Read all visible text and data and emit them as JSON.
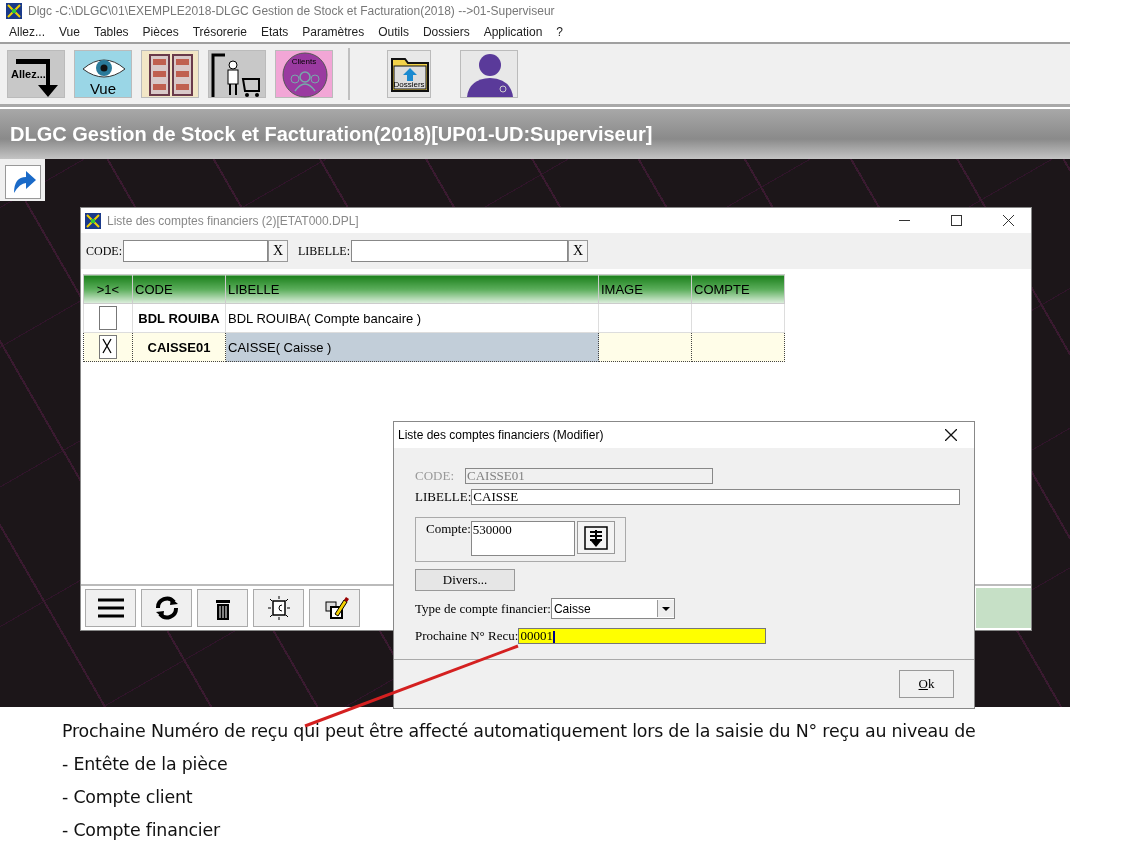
{
  "window": {
    "title": "Dlgc -C:\\DLGC\\01\\EXEMPLE2018-DLGC Gestion de Stock et Facturation(2018) -->01-Superviseur"
  },
  "menu": [
    "Allez...",
    "Vue",
    "Tables",
    "Pièces",
    "Trésorerie",
    "Etats",
    "Paramètres",
    "Outils",
    "Dossiers",
    "Application",
    "?"
  ],
  "toolbar": [
    {
      "kind": "allez",
      "label": "Allez..."
    },
    {
      "kind": "vue",
      "label": "Vue"
    },
    {
      "kind": "tables"
    },
    {
      "kind": "stock"
    },
    {
      "kind": "clients",
      "label": "Clients"
    },
    {
      "kind": "separator"
    },
    {
      "kind": "folder",
      "label": "Dossiers"
    },
    {
      "kind": "user"
    }
  ],
  "banner": "DLGC Gestion de Stock et Facturation(2018)[UP01-UD:Superviseur]",
  "list_window": {
    "title": "Liste des comptes financiers (2)[ETAT000.DPL]",
    "filters": [
      {
        "label": "CODE:",
        "clear": "X"
      },
      {
        "label": "LIBELLE:",
        "clear": "X"
      }
    ],
    "columns": [
      ">1<",
      "CODE",
      "LIBELLE",
      "IMAGE",
      "COMPTE"
    ],
    "rows": [
      {
        "checked": false,
        "selected": false,
        "code": "BDL ROUIBA",
        "libelle": "BDL ROUIBA( Compte bancaire )"
      },
      {
        "checked": true,
        "selected": true,
        "code": "CAISSE01",
        "libelle": "CAISSE( Caisse )"
      }
    ],
    "tools": [
      {
        "kind": "menu"
      },
      {
        "kind": "refresh"
      },
      {
        "kind": "trash"
      },
      {
        "kind": "capture"
      },
      {
        "kind": "edit"
      }
    ]
  },
  "dialog": {
    "title": "Liste des comptes financiers  (Modifier)",
    "code": {
      "label": "CODE:",
      "value": "CAISSE01",
      "disabled": true
    },
    "libelle": {
      "label": "LIBELLE:",
      "value": "CAISSE"
    },
    "compte": {
      "label": "Compte:",
      "value": "530000"
    },
    "divers_button": "Divers...",
    "type": {
      "label": "Type de compte financier:",
      "value": "Caisse"
    },
    "recu": {
      "label": "Prochaine N° Recu:",
      "value": "00001"
    },
    "ok_button": "Ok"
  },
  "annotation": {
    "text": "Prochaine Numéro de reçu qui peut être affecté automatiquement lors de la saisie du N° reçu au niveau de",
    "items": [
      "- Entête de la pièce",
      "- Compte client",
      "- Compte financier"
    ]
  }
}
